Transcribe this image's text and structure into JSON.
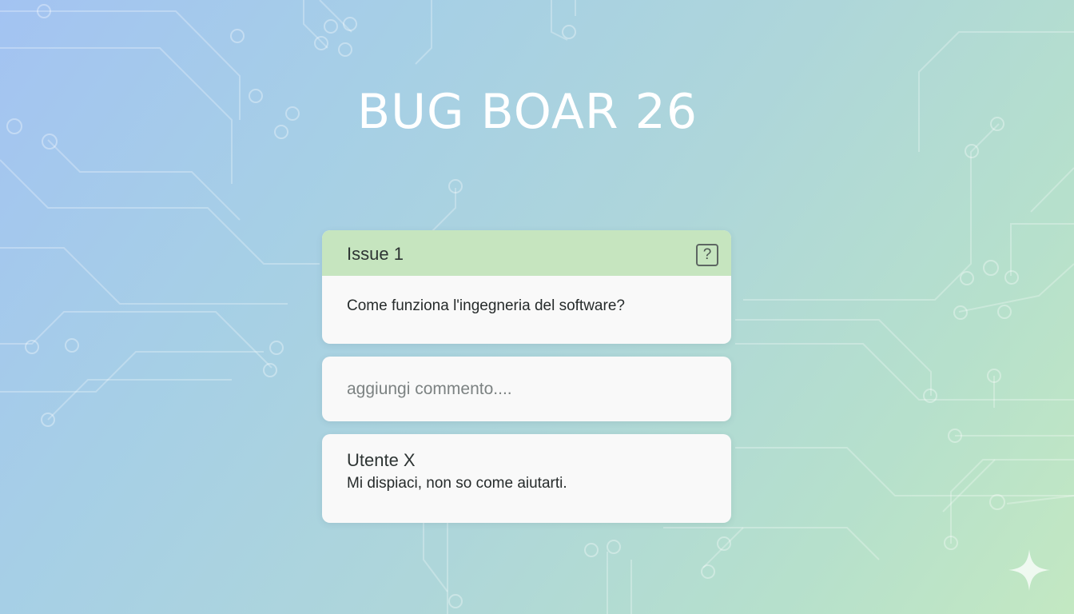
{
  "app": {
    "title": "BUG BOAR 26"
  },
  "issue": {
    "title": "Issue 1",
    "question": "Come funziona l'ingegneria del software?",
    "help_icon": "question-mark-icon",
    "help_label": "?"
  },
  "comment_input": {
    "placeholder": "aggiungi commento...."
  },
  "comments": [
    {
      "author": "Utente X",
      "text": "Mi dispiaci, non so come aiutarti."
    }
  ],
  "colors": {
    "issue_header": "#c6e5bf",
    "card_background": "#f9f9f9"
  }
}
